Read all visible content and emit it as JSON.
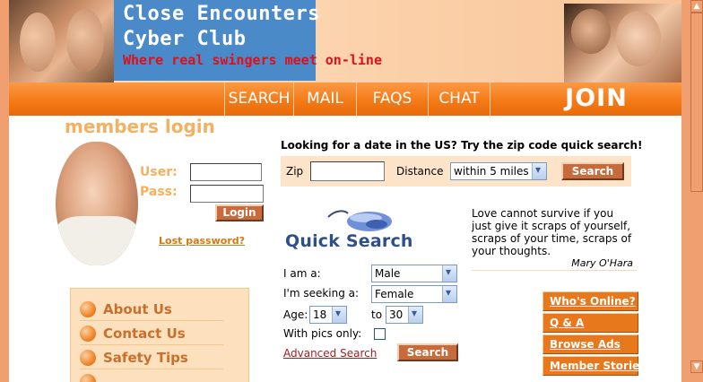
{
  "header": {
    "title_line1": "Close Encounters",
    "title_line2": "Cyber Club",
    "tagline": "Where real swingers meet on-line"
  },
  "nav": {
    "search": "SEARCH",
    "mail": "MAIL",
    "faqs": "FAQS",
    "chat": "CHAT",
    "join": "JOIN"
  },
  "login": {
    "title": "members login",
    "user_label": "User:",
    "pass_label": "Pass:",
    "user_value": "",
    "pass_value": "",
    "button": "Login",
    "lost_password": "Lost password?"
  },
  "menu": {
    "items": [
      {
        "label": "About Us"
      },
      {
        "label": "Contact Us"
      },
      {
        "label": "Safety Tips"
      },
      {
        "label": ""
      }
    ]
  },
  "zip_search": {
    "heading": "Looking for a date in the US? Try the zip code quick search!",
    "zip_label": "Zip",
    "zip_value": "",
    "distance_label": "Distance",
    "distance_value": "within 5 miles",
    "button": "Search"
  },
  "quick_search": {
    "title": "Quick Search",
    "iam_label": "I am a:",
    "iam_value": "Male",
    "seeking_label": "I'm seeking a:",
    "seeking_value": "Female",
    "age_label": "Age:",
    "age_from": "18",
    "to_label": "to",
    "age_to": "30",
    "pics_label": "With pics only:",
    "pics_checked": false,
    "advanced_link": "Advanced Search",
    "button": "Search"
  },
  "quote": {
    "text": "Love cannot survive if you just give it scraps of yourself, scraps of your time, scraps of your thoughts.",
    "author": "Mary O'Hara"
  },
  "side_links": {
    "whos_online": "Who's Online?",
    "qa": "Q & A",
    "browse_ads": "Browse Ads",
    "member_stories": "Member Stories"
  },
  "colors": {
    "nav_orange": "#f47a18",
    "title_blue": "#4a8ac8",
    "tagline_red": "#e0101a",
    "login_tan": "#f5b060",
    "button_brown": "#c86a3a",
    "quick_search_blue": "#2e4f8a"
  },
  "icons": {
    "mouse": "computer-mouse-icon",
    "menu_bullet": "orange-ball-bullet-icon"
  }
}
